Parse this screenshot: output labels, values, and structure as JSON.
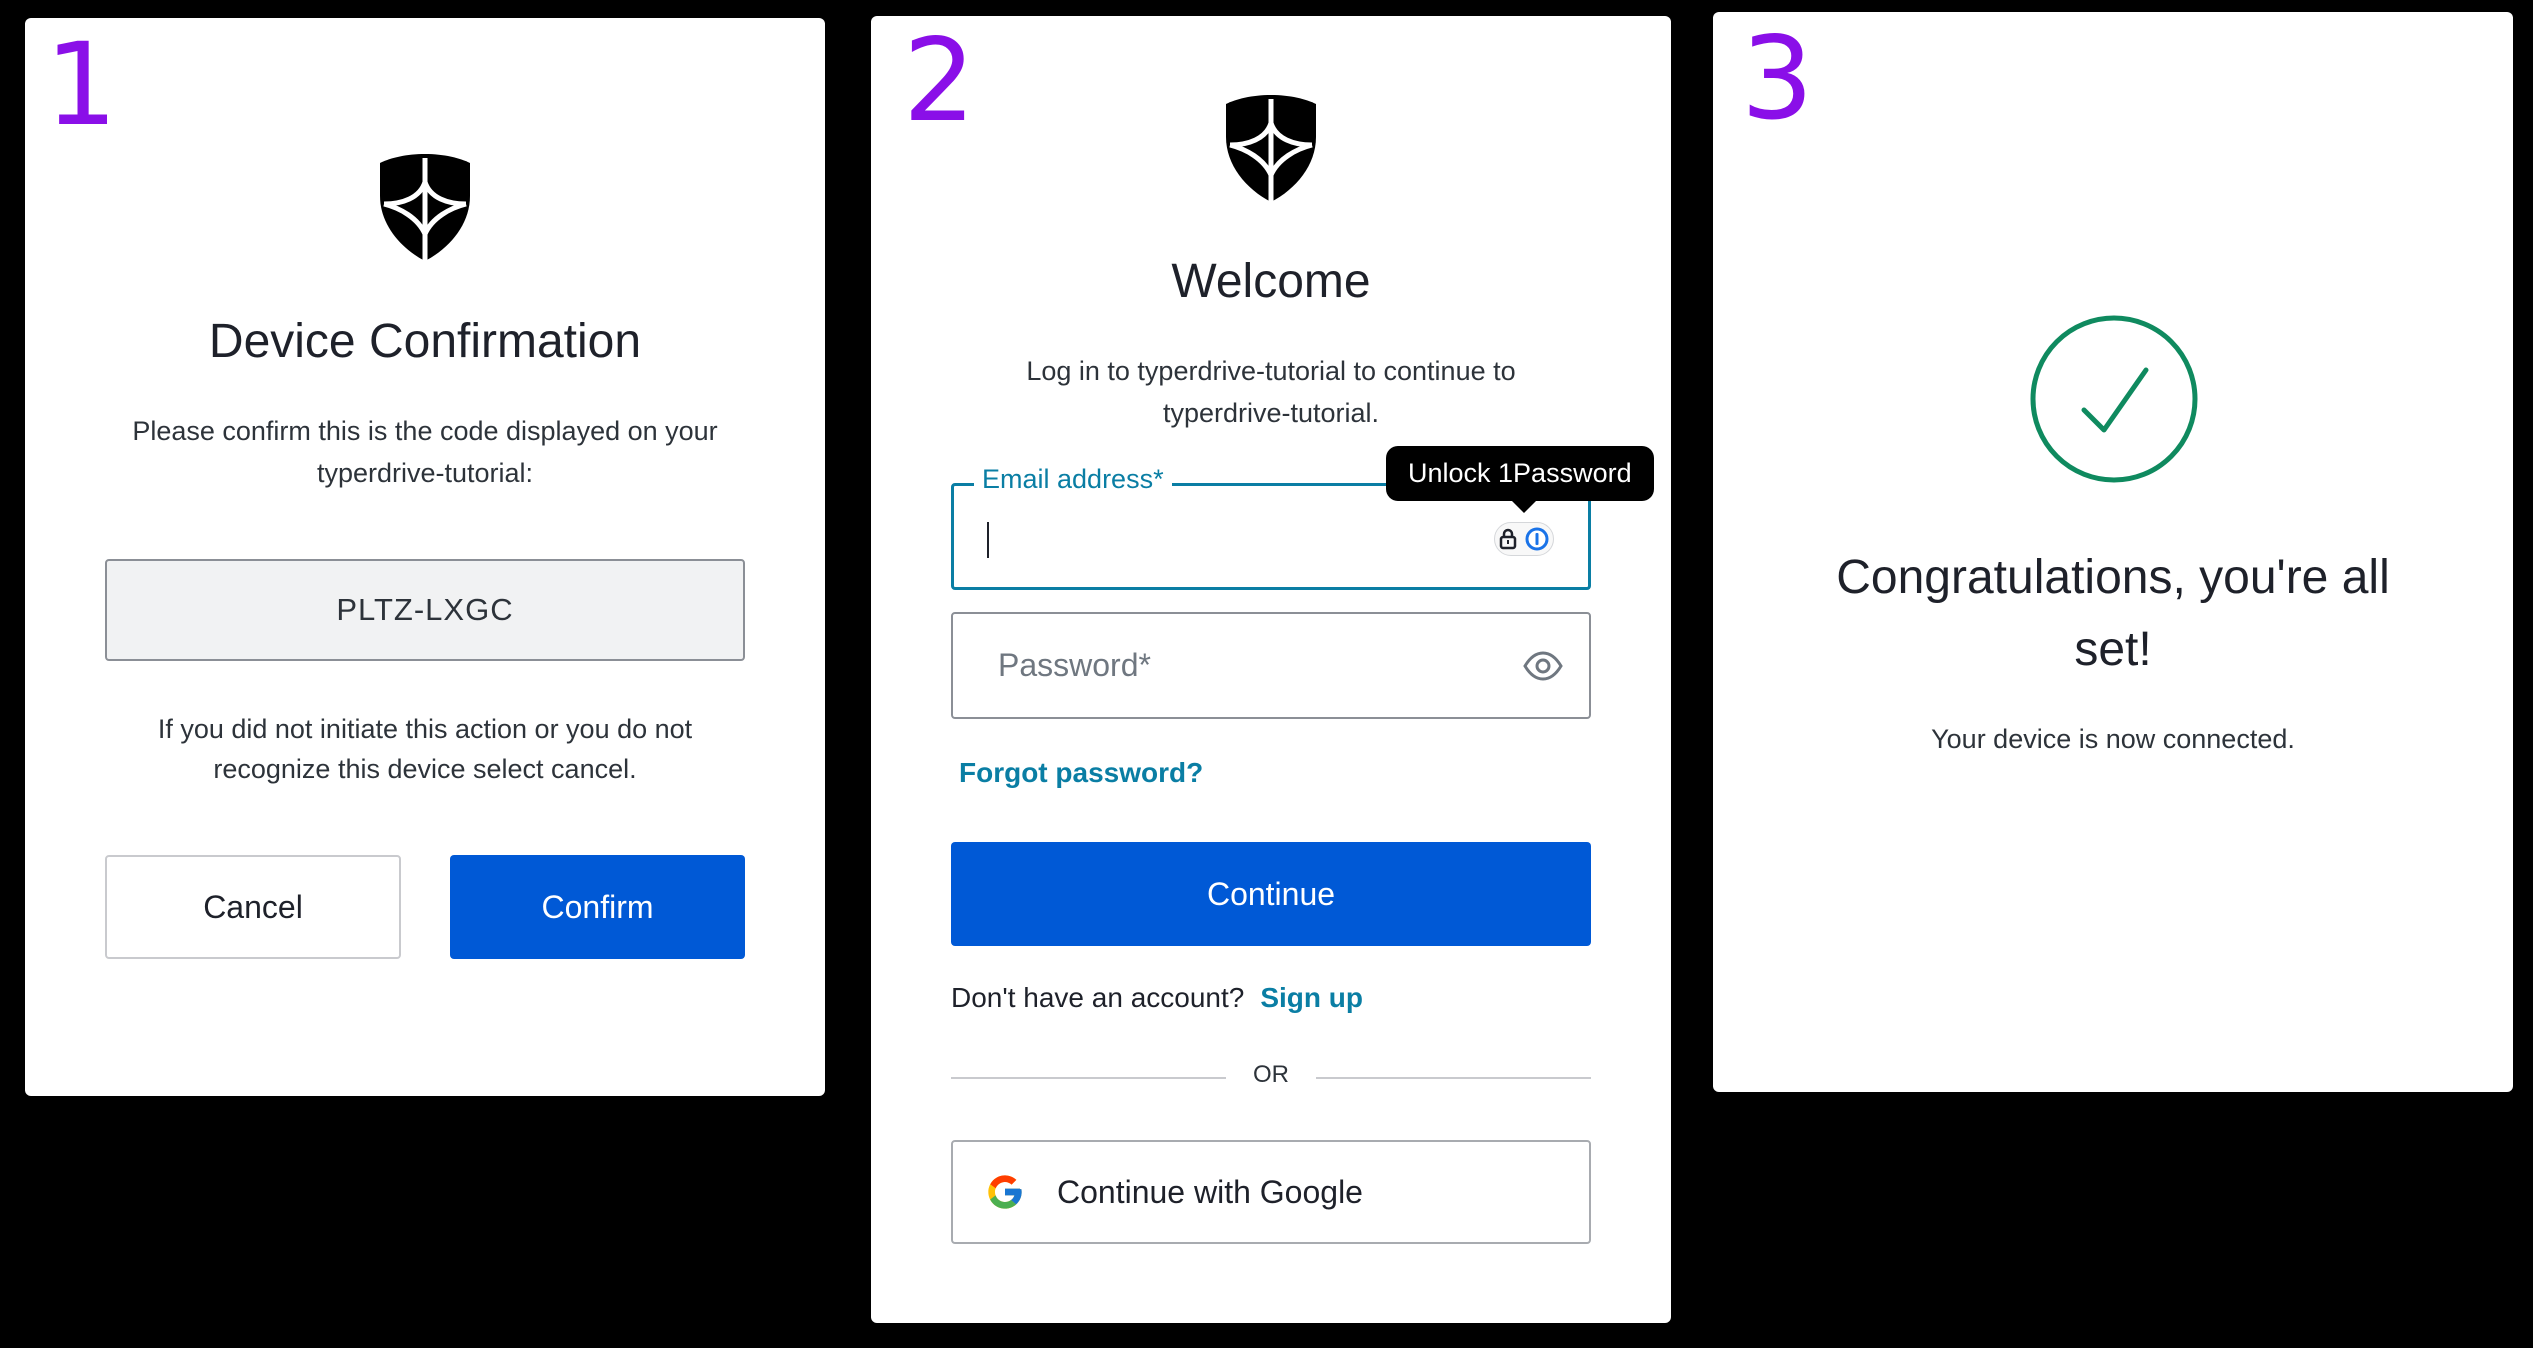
{
  "panel1": {
    "step": "1",
    "title": "Device Confirmation",
    "instruction_line1": "Please confirm this is the code displayed on your",
    "instruction_line2": "typerdrive-tutorial:",
    "code": "PLTZ-LXGC",
    "warning_line1": "If you did not initiate this action or you do not",
    "warning_line2": "recognize this device select cancel.",
    "cancel_label": "Cancel",
    "confirm_label": "Confirm"
  },
  "panel2": {
    "step": "2",
    "title": "Welcome",
    "subtitle_line1": "Log in to typerdrive-tutorial to continue to",
    "subtitle_line2": "typerdrive-tutorial.",
    "email_label": "Email address*",
    "email_value": "",
    "tooltip": "Unlock 1Password",
    "password_placeholder": "Password*",
    "forgot_password": "Forgot password?",
    "continue_label": "Continue",
    "no_account": "Don't have an account?",
    "signup": "Sign up",
    "or": "OR",
    "google_label": "Continue with Google"
  },
  "panel3": {
    "step": "3",
    "title_line1": "Congratulations, you're all",
    "title_line2": "set!",
    "message": "Your device is now connected."
  },
  "colors": {
    "primary": "#0059d6",
    "link": "#0a7ea4",
    "success": "#0f8a5f",
    "step_number": "#8a0fe8"
  },
  "icons": {
    "logo": "shield-logo-icon",
    "eye": "eye-icon",
    "lock": "lock-icon",
    "onepassword": "onepassword-icon",
    "google": "google-icon",
    "check": "check-circle-icon"
  }
}
